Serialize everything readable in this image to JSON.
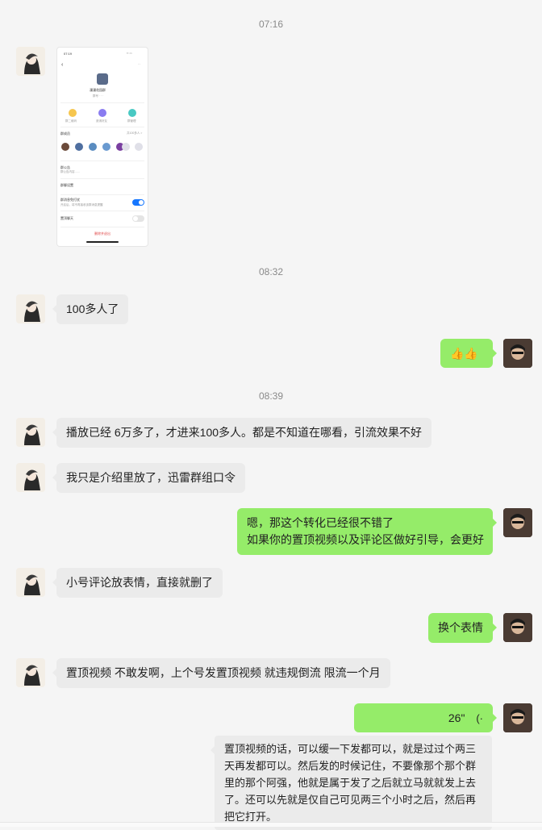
{
  "timestamps": [
    "07:16",
    "08:32",
    "08:39"
  ],
  "shared_screenshot": {
    "status_time": "07:19",
    "group_name": "漫漫花园群",
    "group_sub": "群号 ·  ·  ·  ",
    "actions": [
      "群二维码",
      "邀请好友",
      "群管理"
    ],
    "members_label": "群成员",
    "members_more": "共100多人 >",
    "rows": [
      "群公告",
      "群聊设置",
      "群消息免打扰",
      "置顶聊天"
    ],
    "row_subs": [
      "群公告内容……",
      "",
      "开启后，将不再接收该群消息提醒",
      ""
    ],
    "footer": "删除并退出",
    "accent_colors": [
      "#f6c64f",
      "#8a7cf0",
      "#49c9c3"
    ]
  },
  "messages": [
    {
      "side": "in",
      "text": "100多人了"
    },
    {
      "side": "out",
      "text": "👍👍"
    },
    {
      "side": "in",
      "text": "播放已经 6万多了，才进来100多人。都是不知道在哪看，引流效果不好"
    },
    {
      "side": "in",
      "text": "我只是介绍里放了，迅雷群组口令"
    },
    {
      "side": "out",
      "lines": [
        "嗯，那这个转化已经很不错了",
        "如果你的置顶视频以及评论区做好引导，会更好"
      ]
    },
    {
      "side": "in",
      "text": "小号评论放表情，直接就删了"
    },
    {
      "side": "out",
      "text": "换个表情"
    },
    {
      "side": "in",
      "text": "置顶视频 不敢发啊，上个号发置顶视频 就违规倒流 限流一个月"
    },
    {
      "side": "out",
      "voice": "26\"",
      "transcript": "置顶视频的话，可以缓一下发都可以，就是过过个两三天再发都可以。然后发的时候记住，不要像那个那个群里的那个阿强，他就是属于发了之后就立马就就发上去了。还可以先就是仅自己可见两三个小时之后，然后再把它打开。"
    }
  ],
  "colors": {
    "incoming": "#ebebeb",
    "outgoing": "#95ec69",
    "background": "#f5f5f5"
  }
}
